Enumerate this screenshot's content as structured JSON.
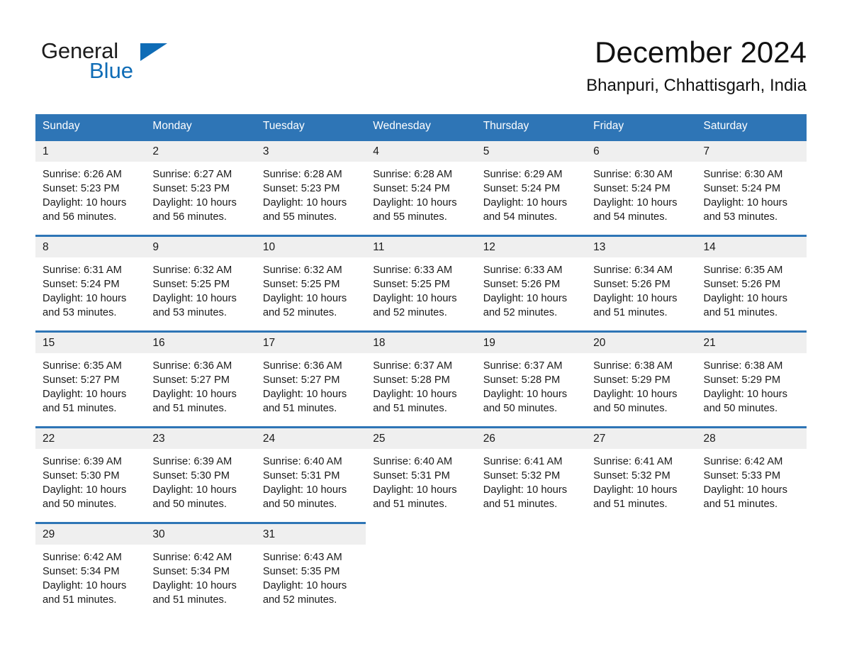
{
  "logo": {
    "text_primary": "General",
    "text_secondary": "Blue",
    "triangle_color": "#0f6cb6"
  },
  "header": {
    "title": "December 2024",
    "subtitle": "Bhanpuri, Chhattisgarh, India"
  },
  "theme": {
    "header_bg": "#2e75b6",
    "header_text": "#ffffff",
    "daynum_bg": "#efefef",
    "row_border": "#2e75b6",
    "page_bg": "#ffffff"
  },
  "weekday_headers": [
    "Sunday",
    "Monday",
    "Tuesday",
    "Wednesday",
    "Thursday",
    "Friday",
    "Saturday"
  ],
  "weeks": [
    [
      {
        "day": "1",
        "sunrise": "Sunrise: 6:26 AM",
        "sunset": "Sunset: 5:23 PM",
        "daylight_line1": "Daylight: 10 hours",
        "daylight_line2": "and 56 minutes."
      },
      {
        "day": "2",
        "sunrise": "Sunrise: 6:27 AM",
        "sunset": "Sunset: 5:23 PM",
        "daylight_line1": "Daylight: 10 hours",
        "daylight_line2": "and 56 minutes."
      },
      {
        "day": "3",
        "sunrise": "Sunrise: 6:28 AM",
        "sunset": "Sunset: 5:23 PM",
        "daylight_line1": "Daylight: 10 hours",
        "daylight_line2": "and 55 minutes."
      },
      {
        "day": "4",
        "sunrise": "Sunrise: 6:28 AM",
        "sunset": "Sunset: 5:24 PM",
        "daylight_line1": "Daylight: 10 hours",
        "daylight_line2": "and 55 minutes."
      },
      {
        "day": "5",
        "sunrise": "Sunrise: 6:29 AM",
        "sunset": "Sunset: 5:24 PM",
        "daylight_line1": "Daylight: 10 hours",
        "daylight_line2": "and 54 minutes."
      },
      {
        "day": "6",
        "sunrise": "Sunrise: 6:30 AM",
        "sunset": "Sunset: 5:24 PM",
        "daylight_line1": "Daylight: 10 hours",
        "daylight_line2": "and 54 minutes."
      },
      {
        "day": "7",
        "sunrise": "Sunrise: 6:30 AM",
        "sunset": "Sunset: 5:24 PM",
        "daylight_line1": "Daylight: 10 hours",
        "daylight_line2": "and 53 minutes."
      }
    ],
    [
      {
        "day": "8",
        "sunrise": "Sunrise: 6:31 AM",
        "sunset": "Sunset: 5:24 PM",
        "daylight_line1": "Daylight: 10 hours",
        "daylight_line2": "and 53 minutes."
      },
      {
        "day": "9",
        "sunrise": "Sunrise: 6:32 AM",
        "sunset": "Sunset: 5:25 PM",
        "daylight_line1": "Daylight: 10 hours",
        "daylight_line2": "and 53 minutes."
      },
      {
        "day": "10",
        "sunrise": "Sunrise: 6:32 AM",
        "sunset": "Sunset: 5:25 PM",
        "daylight_line1": "Daylight: 10 hours",
        "daylight_line2": "and 52 minutes."
      },
      {
        "day": "11",
        "sunrise": "Sunrise: 6:33 AM",
        "sunset": "Sunset: 5:25 PM",
        "daylight_line1": "Daylight: 10 hours",
        "daylight_line2": "and 52 minutes."
      },
      {
        "day": "12",
        "sunrise": "Sunrise: 6:33 AM",
        "sunset": "Sunset: 5:26 PM",
        "daylight_line1": "Daylight: 10 hours",
        "daylight_line2": "and 52 minutes."
      },
      {
        "day": "13",
        "sunrise": "Sunrise: 6:34 AM",
        "sunset": "Sunset: 5:26 PM",
        "daylight_line1": "Daylight: 10 hours",
        "daylight_line2": "and 51 minutes."
      },
      {
        "day": "14",
        "sunrise": "Sunrise: 6:35 AM",
        "sunset": "Sunset: 5:26 PM",
        "daylight_line1": "Daylight: 10 hours",
        "daylight_line2": "and 51 minutes."
      }
    ],
    [
      {
        "day": "15",
        "sunrise": "Sunrise: 6:35 AM",
        "sunset": "Sunset: 5:27 PM",
        "daylight_line1": "Daylight: 10 hours",
        "daylight_line2": "and 51 minutes."
      },
      {
        "day": "16",
        "sunrise": "Sunrise: 6:36 AM",
        "sunset": "Sunset: 5:27 PM",
        "daylight_line1": "Daylight: 10 hours",
        "daylight_line2": "and 51 minutes."
      },
      {
        "day": "17",
        "sunrise": "Sunrise: 6:36 AM",
        "sunset": "Sunset: 5:27 PM",
        "daylight_line1": "Daylight: 10 hours",
        "daylight_line2": "and 51 minutes."
      },
      {
        "day": "18",
        "sunrise": "Sunrise: 6:37 AM",
        "sunset": "Sunset: 5:28 PM",
        "daylight_line1": "Daylight: 10 hours",
        "daylight_line2": "and 51 minutes."
      },
      {
        "day": "19",
        "sunrise": "Sunrise: 6:37 AM",
        "sunset": "Sunset: 5:28 PM",
        "daylight_line1": "Daylight: 10 hours",
        "daylight_line2": "and 50 minutes."
      },
      {
        "day": "20",
        "sunrise": "Sunrise: 6:38 AM",
        "sunset": "Sunset: 5:29 PM",
        "daylight_line1": "Daylight: 10 hours",
        "daylight_line2": "and 50 minutes."
      },
      {
        "day": "21",
        "sunrise": "Sunrise: 6:38 AM",
        "sunset": "Sunset: 5:29 PM",
        "daylight_line1": "Daylight: 10 hours",
        "daylight_line2": "and 50 minutes."
      }
    ],
    [
      {
        "day": "22",
        "sunrise": "Sunrise: 6:39 AM",
        "sunset": "Sunset: 5:30 PM",
        "daylight_line1": "Daylight: 10 hours",
        "daylight_line2": "and 50 minutes."
      },
      {
        "day": "23",
        "sunrise": "Sunrise: 6:39 AM",
        "sunset": "Sunset: 5:30 PM",
        "daylight_line1": "Daylight: 10 hours",
        "daylight_line2": "and 50 minutes."
      },
      {
        "day": "24",
        "sunrise": "Sunrise: 6:40 AM",
        "sunset": "Sunset: 5:31 PM",
        "daylight_line1": "Daylight: 10 hours",
        "daylight_line2": "and 50 minutes."
      },
      {
        "day": "25",
        "sunrise": "Sunrise: 6:40 AM",
        "sunset": "Sunset: 5:31 PM",
        "daylight_line1": "Daylight: 10 hours",
        "daylight_line2": "and 51 minutes."
      },
      {
        "day": "26",
        "sunrise": "Sunrise: 6:41 AM",
        "sunset": "Sunset: 5:32 PM",
        "daylight_line1": "Daylight: 10 hours",
        "daylight_line2": "and 51 minutes."
      },
      {
        "day": "27",
        "sunrise": "Sunrise: 6:41 AM",
        "sunset": "Sunset: 5:32 PM",
        "daylight_line1": "Daylight: 10 hours",
        "daylight_line2": "and 51 minutes."
      },
      {
        "day": "28",
        "sunrise": "Sunrise: 6:42 AM",
        "sunset": "Sunset: 5:33 PM",
        "daylight_line1": "Daylight: 10 hours",
        "daylight_line2": "and 51 minutes."
      }
    ],
    [
      {
        "day": "29",
        "sunrise": "Sunrise: 6:42 AM",
        "sunset": "Sunset: 5:34 PM",
        "daylight_line1": "Daylight: 10 hours",
        "daylight_line2": "and 51 minutes."
      },
      {
        "day": "30",
        "sunrise": "Sunrise: 6:42 AM",
        "sunset": "Sunset: 5:34 PM",
        "daylight_line1": "Daylight: 10 hours",
        "daylight_line2": "and 51 minutes."
      },
      {
        "day": "31",
        "sunrise": "Sunrise: 6:43 AM",
        "sunset": "Sunset: 5:35 PM",
        "daylight_line1": "Daylight: 10 hours",
        "daylight_line2": "and 52 minutes."
      },
      {
        "day": "",
        "sunrise": "",
        "sunset": "",
        "daylight_line1": "",
        "daylight_line2": ""
      },
      {
        "day": "",
        "sunrise": "",
        "sunset": "",
        "daylight_line1": "",
        "daylight_line2": ""
      },
      {
        "day": "",
        "sunrise": "",
        "sunset": "",
        "daylight_line1": "",
        "daylight_line2": ""
      },
      {
        "day": "",
        "sunrise": "",
        "sunset": "",
        "daylight_line1": "",
        "daylight_line2": ""
      }
    ]
  ]
}
